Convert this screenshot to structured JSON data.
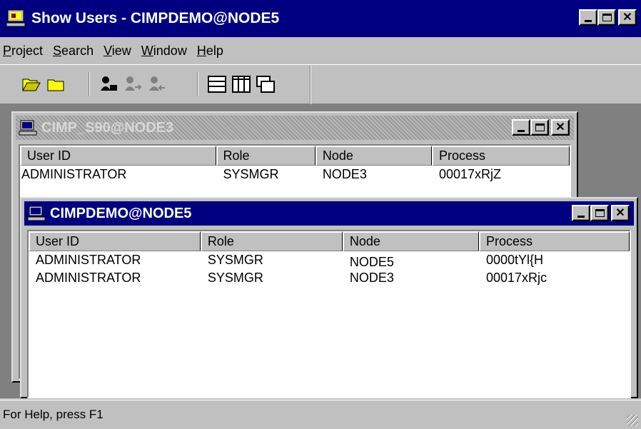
{
  "app": {
    "title": "Show Users - CIMPDEMO@NODE5",
    "menu": [
      "Project",
      "Search",
      "View",
      "Window",
      "Help"
    ],
    "menu_underline": [
      "P",
      "S",
      "V",
      "W",
      "H"
    ],
    "status": "For Help, press F1",
    "icons": [
      "open-folder-icon",
      "folder-icon",
      "find-user-icon",
      "user-next-icon",
      "user-prev-icon",
      "cascade-icon",
      "tile-vertical-icon",
      "tile-horizontal-icon"
    ]
  },
  "windows": {
    "back": {
      "title": "CIMP_S90@NODE3",
      "columns": [
        "User ID",
        "Role",
        "Node",
        "Process"
      ],
      "rows": [
        [
          "ADMINISTRATOR",
          "SYSMGR",
          "NODE3",
          "00017xRjZ"
        ]
      ]
    },
    "front": {
      "title": "CIMPDEMO@NODE5",
      "columns": [
        "User ID",
        "Role",
        "Node",
        "Process"
      ],
      "rows": [
        [
          "ADMINISTRATOR",
          "SYSMGR",
          "NODE5",
          "0000tYl{H"
        ],
        [
          "ADMINISTRATOR",
          "SYSMGR",
          "NODE3",
          "00017xRjc"
        ]
      ]
    }
  },
  "colors": {
    "active_title": "#000080",
    "face": "#c0c0c0",
    "mdi_bg": "#808080"
  }
}
